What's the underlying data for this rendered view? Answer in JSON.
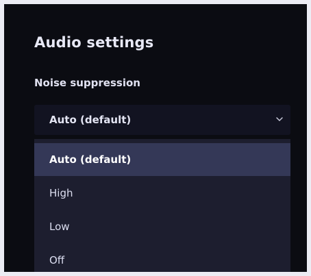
{
  "settings": {
    "title": "Audio settings",
    "noise_suppression": {
      "label": "Noise suppression",
      "selected_value": "Auto (default)",
      "options": [
        "Auto (default)",
        "High",
        "Low",
        "Off"
      ]
    }
  },
  "icons": {
    "dropdown": "chevron-down-icon"
  },
  "colors": {
    "background": "#0b0c12",
    "menu": "#1d1e2f",
    "selected_item": "#343857",
    "text": "#e4e5f3"
  }
}
